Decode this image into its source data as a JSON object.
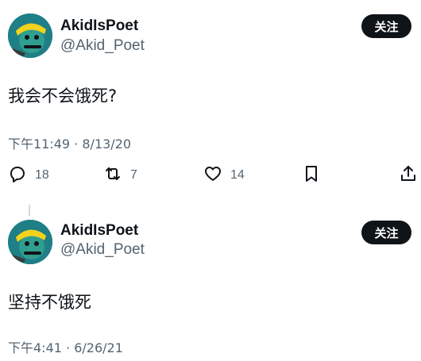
{
  "tweets": [
    {
      "author_name": "AkidIsPoet",
      "author_handle": "@Akid_Poet",
      "follow_label": "关注",
      "text": "我会不会饿死?",
      "timestamp": "下午11:49 · 8/13/20",
      "replies": "18",
      "retweets": "7",
      "likes": "14"
    },
    {
      "author_name": "AkidIsPoet",
      "author_handle": "@Akid_Poet",
      "follow_label": "关注",
      "text": "坚持不饿死",
      "timestamp": "下午4:41 · 6/26/21"
    }
  ],
  "icons": {
    "reply": "reply-icon",
    "retweet": "retweet-icon",
    "like": "heart-icon",
    "bookmark": "bookmark-icon",
    "share": "share-icon"
  },
  "colors": {
    "text_primary": "#0f1419",
    "text_secondary": "#536471",
    "follow_button_bg": "#0f1419",
    "avatar_bg": "#1f7f86"
  }
}
